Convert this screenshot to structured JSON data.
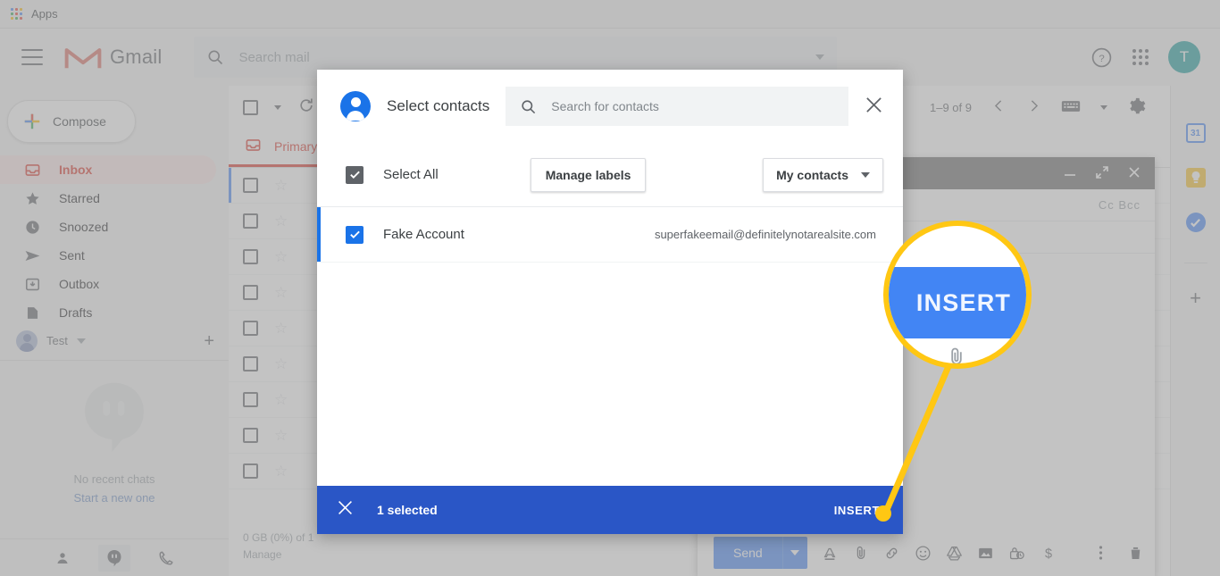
{
  "browser": {
    "apps_label": "Apps",
    "apps_icon": "apps-grid-icon"
  },
  "header": {
    "menu_icon": "hamburger-menu-icon",
    "logo_icon": "gmail-m-logo-icon",
    "brand": "Gmail",
    "search": {
      "icon": "search-icon",
      "placeholder": "Search mail",
      "value": "",
      "options_icon": "chevron-down-icon"
    },
    "help_icon": "help-circle-icon",
    "apps_icon": "google-apps-grid-icon",
    "avatar_initial": "T"
  },
  "sidebar": {
    "compose": {
      "label": "Compose",
      "icon": "plus-icon"
    },
    "items": [
      {
        "label": "Inbox",
        "icon": "inbox-icon",
        "active": true
      },
      {
        "label": "Starred",
        "icon": "star-icon",
        "active": false
      },
      {
        "label": "Snoozed",
        "icon": "clock-icon",
        "active": false
      },
      {
        "label": "Sent",
        "icon": "send-icon",
        "active": false
      },
      {
        "label": "Outbox",
        "icon": "outbox-icon",
        "active": false
      },
      {
        "label": "Drafts",
        "icon": "drafts-icon",
        "active": false
      }
    ],
    "account": {
      "name": "Test",
      "caret_icon": "chevron-down-icon",
      "add_icon": "plus-icon",
      "avatar_icon": "person-avatar-icon"
    },
    "chat": {
      "empty_icon": "hangouts-icon",
      "empty_title": "No recent chats",
      "empty_action": "Start a new one",
      "tools": [
        {
          "icon": "contacts-person-icon",
          "selected": false
        },
        {
          "icon": "hangouts-chat-icon",
          "selected": true
        },
        {
          "icon": "phone-icon",
          "selected": false
        }
      ]
    }
  },
  "maillist": {
    "select_all_icon": "checkbox-icon",
    "select_all_caret": "chevron-down-icon",
    "refresh_icon": "refresh-icon",
    "pager_text": "1–9 of 9",
    "prev_icon": "chevron-left-icon",
    "next_icon": "chevron-right-icon",
    "keyboard_icon": "keyboard-icon",
    "keyboard_caret": "chevron-down-icon",
    "settings_icon": "gear-icon",
    "tabs": [
      {
        "label": "Primary",
        "icon": "inbox-tab-icon",
        "active": true
      }
    ],
    "row_count": 9,
    "storage_text": "0 GB (0%) of 1",
    "storage_manage": "Manage"
  },
  "rail": {
    "items": [
      {
        "icon": "google-calendar-icon",
        "label": "31",
        "color": "#4285f4"
      },
      {
        "icon": "google-keep-icon",
        "label": "",
        "color": "#f6bf26"
      },
      {
        "icon": "google-tasks-icon",
        "label": "",
        "color": "#4285f4"
      }
    ],
    "add_icon": "plus-icon"
  },
  "compose": {
    "minimize_icon": "minimize-icon",
    "expand_icon": "expand-icon",
    "close_icon": "close-icon",
    "cc_bcc": "Cc Bcc",
    "send_label": "Send",
    "send_caret_icon": "chevron-down-icon",
    "toolbar_icons": [
      "formatting-A-icon",
      "attach-paperclip-icon",
      "insert-link-icon",
      "insert-emoji-icon",
      "google-drive-icon",
      "insert-photo-icon",
      "confidential-mode-icon",
      "insert-money-icon"
    ],
    "more_icon": "more-vertical-icon",
    "trash_icon": "trash-icon"
  },
  "dialog": {
    "avatar_icon": "contacts-person-icon",
    "title": "Select contacts",
    "search": {
      "icon": "search-icon",
      "placeholder": "Search for contacts",
      "value": ""
    },
    "close_icon": "close-icon",
    "select_all": {
      "label": "Select All",
      "checked": true,
      "checkbox_color": "#5f6368"
    },
    "manage_labels": "Manage labels",
    "contacts_filter": {
      "label": "My contacts",
      "caret_icon": "chevron-down-icon"
    },
    "contacts": [
      {
        "name": "Fake Account",
        "email": "superfakeemail@definitelynotarealsite.com",
        "checked": true
      }
    ],
    "bottom": {
      "close_icon": "close-icon",
      "count_text": "1 selected",
      "insert_label": "INSERT",
      "bar_color": "#2a56c6"
    }
  },
  "callout": {
    "magnified_label": "INSERT",
    "ring_color": "#ffc713",
    "button_color": "#4285f4",
    "mag_icons": [
      "formatting-A-icon",
      "attach-paperclip-icon",
      "insert-link-icon"
    ]
  },
  "colors": {
    "gmail_red": "#d93025",
    "blue": "#1a73e8",
    "highlight_yellow": "#ffc713"
  }
}
